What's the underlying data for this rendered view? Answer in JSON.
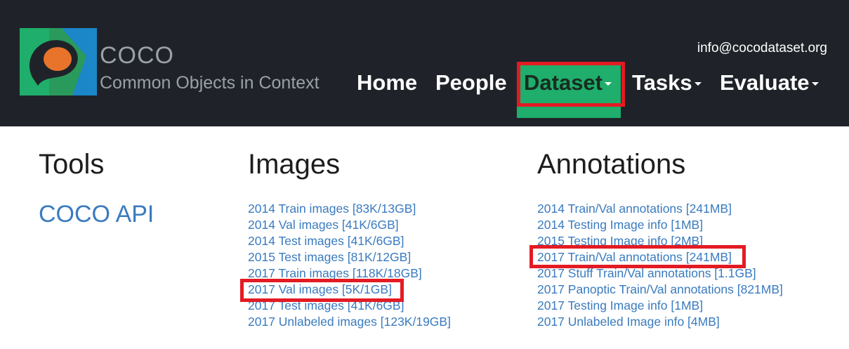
{
  "header": {
    "brand_title": "COCO",
    "brand_subtitle": "Common Objects in Context",
    "email": "info@cocodataset.org",
    "nav": {
      "home": "Home",
      "people": "People",
      "dataset": "Dataset",
      "tasks": "Tasks",
      "evaluate": "Evaluate"
    }
  },
  "columns": {
    "tools": {
      "title": "Tools",
      "link": "COCO API"
    },
    "images": {
      "title": "Images",
      "links": [
        "2014 Train images [83K/13GB]",
        "2014 Val images [41K/6GB]",
        "2014 Test images [41K/6GB]",
        "2015 Test images [81K/12GB]",
        "2017 Train images [118K/18GB]",
        "2017 Val images [5K/1GB]",
        "2017 Test images [41K/6GB]",
        "2017 Unlabeled images [123K/19GB]"
      ]
    },
    "annotations": {
      "title": "Annotations",
      "links": [
        "2014 Train/Val annotations [241MB]",
        "2014 Testing Image info [1MB]",
        "2015 Testing Image info [2MB]",
        "2017 Train/Val annotations [241MB]",
        "2017 Stuff Train/Val annotations [1.1GB]",
        "2017 Panoptic Train/Val annotations [821MB]",
        "2017 Testing Image info [1MB]",
        "2017 Unlabeled Image info [4MB]"
      ]
    }
  },
  "colors": {
    "header_bg": "#1f2329",
    "active_nav_bg": "#1fae6b",
    "highlight": "#e31b23",
    "link": "#3a7bbf"
  },
  "icons": {
    "logo": "coco-logo-icon",
    "caret": "caret-down-icon"
  }
}
